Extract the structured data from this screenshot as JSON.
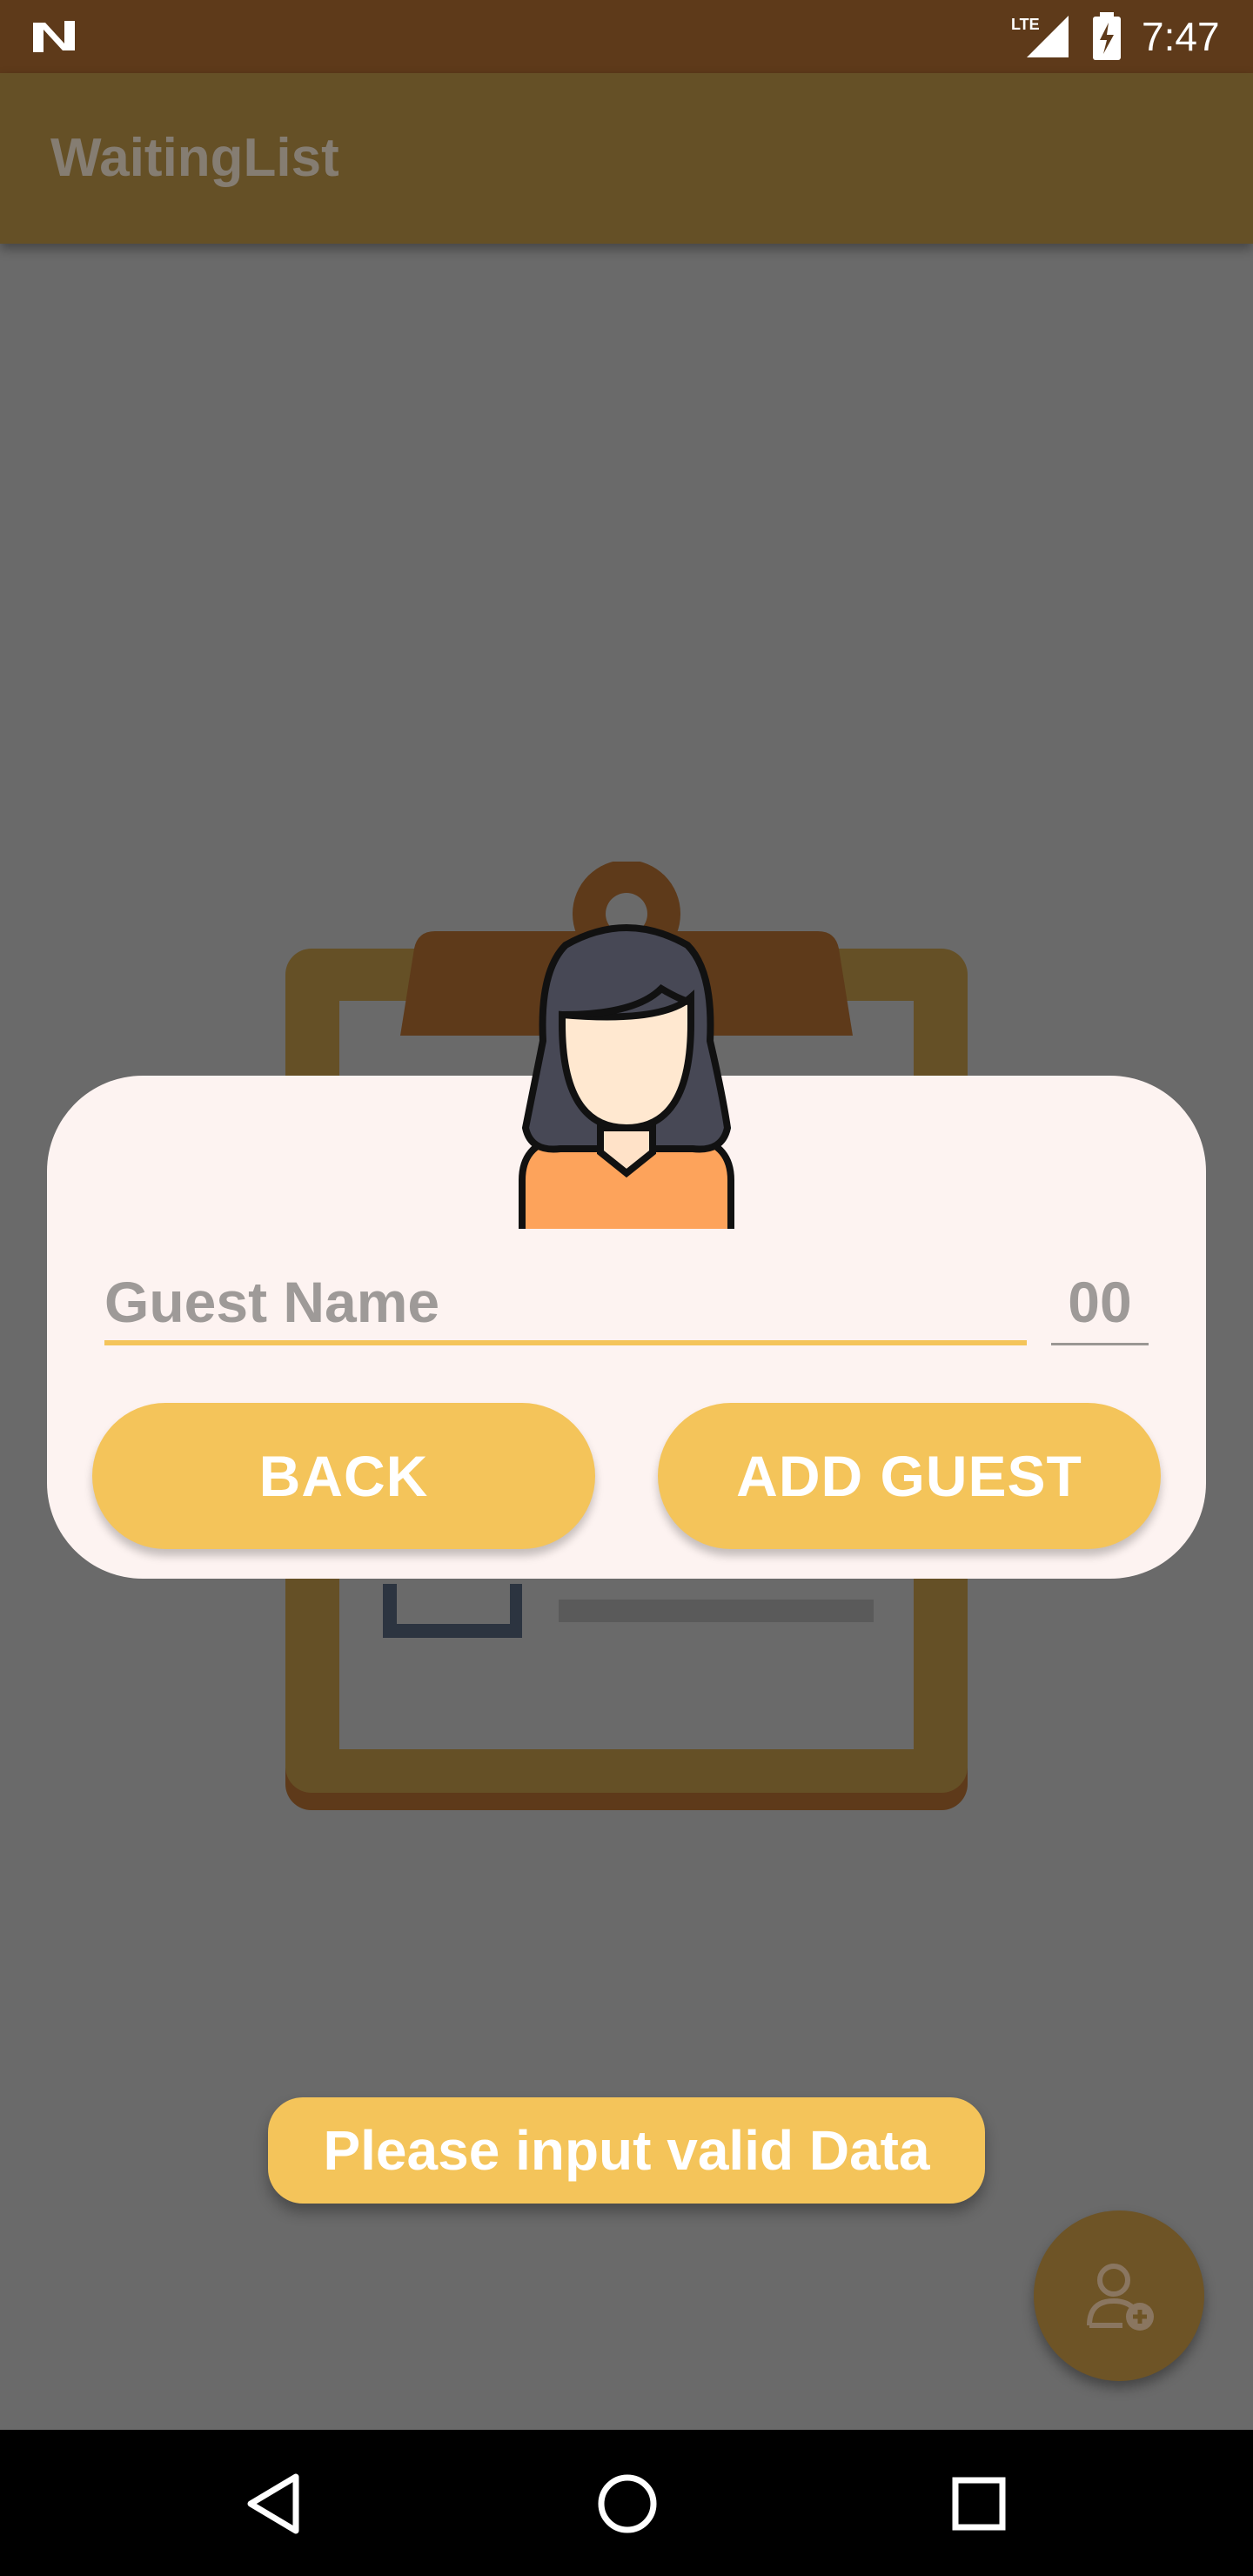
{
  "status_bar": {
    "time": "7:47",
    "network_label": "LTE",
    "icons": [
      "notification-n-icon",
      "lte-signal-icon",
      "battery-charging-icon"
    ]
  },
  "app_bar": {
    "title": "WaitingList"
  },
  "dialog": {
    "avatar_icon": "woman-avatar-icon",
    "name_placeholder": "Guest Name",
    "count_placeholder": "00",
    "back_label": "BACK",
    "add_label": "ADD GUEST"
  },
  "toast": {
    "message": "Please input valid Data"
  },
  "fab": {
    "icon": "add-person-icon"
  },
  "nav_bar": {
    "icons": [
      "back-triangle-icon",
      "home-circle-icon",
      "recents-square-icon"
    ]
  },
  "colors": {
    "accent": "#f4c45a",
    "status_bar": "#5e3a1a",
    "app_bar": "#655026",
    "dialog_bg": "#fdf3f1",
    "scrim": "#6a6a6a"
  }
}
